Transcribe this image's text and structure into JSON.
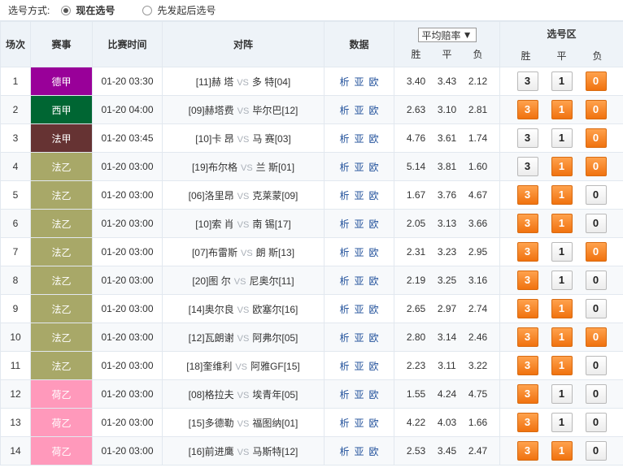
{
  "topbar": {
    "label": "选号方式:",
    "option_current": "现在选号",
    "option_later": "先发起后选号"
  },
  "header": {
    "num": "场次",
    "league": "赛事",
    "time": "比赛时间",
    "match": "对阵",
    "data": "数据",
    "odds_select": "平均赔率",
    "odds_cols": [
      "胜",
      "平",
      "负"
    ],
    "pick_title": "选号区",
    "pick_cols": [
      "胜",
      "平",
      "负"
    ]
  },
  "data_links": [
    "析",
    "亚",
    "欧"
  ],
  "vs_text": "VS",
  "colors": {
    "德甲": "#990099",
    "西甲": "#006633",
    "法甲": "#663333",
    "法乙": "#a8a868",
    "荷乙": "#ff99bb",
    "selected": "#f0720f"
  },
  "matches": [
    {
      "num": "1",
      "league": "德甲",
      "lclass": "c-dejia",
      "time": "01-20 03:30",
      "home_rank": "[11]",
      "home": "赫 塔",
      "away": "多 特",
      "away_rank": "[04]",
      "odds": [
        "3.40",
        "3.43",
        "2.12"
      ],
      "picks": [
        false,
        false,
        true
      ]
    },
    {
      "num": "2",
      "league": "西甲",
      "lclass": "c-xijia",
      "time": "01-20 04:00",
      "home_rank": "[09]",
      "home": "赫塔费",
      "away": "毕尔巴",
      "away_rank": "[12]",
      "odds": [
        "2.63",
        "3.10",
        "2.81"
      ],
      "picks": [
        true,
        true,
        true
      ]
    },
    {
      "num": "3",
      "league": "法甲",
      "lclass": "c-fajia",
      "time": "01-20 03:45",
      "home_rank": "[10]",
      "home": "卡 昂",
      "away": "马 赛",
      "away_rank": "[03]",
      "odds": [
        "4.76",
        "3.61",
        "1.74"
      ],
      "picks": [
        false,
        false,
        true
      ]
    },
    {
      "num": "4",
      "league": "法乙",
      "lclass": "c-fayi",
      "time": "01-20 03:00",
      "home_rank": "[19]",
      "home": "布尔格",
      "away": "兰 斯",
      "away_rank": "[01]",
      "odds": [
        "5.14",
        "3.81",
        "1.60"
      ],
      "picks": [
        false,
        true,
        true
      ]
    },
    {
      "num": "5",
      "league": "法乙",
      "lclass": "c-fayi",
      "time": "01-20 03:00",
      "home_rank": "[06]",
      "home": "洛里昂",
      "away": "克莱蒙",
      "away_rank": "[09]",
      "odds": [
        "1.67",
        "3.76",
        "4.67"
      ],
      "picks": [
        true,
        true,
        false
      ]
    },
    {
      "num": "6",
      "league": "法乙",
      "lclass": "c-fayi",
      "time": "01-20 03:00",
      "home_rank": "[10]",
      "home": "索 肖",
      "away": "南 锡",
      "away_rank": "[17]",
      "odds": [
        "2.05",
        "3.13",
        "3.66"
      ],
      "picks": [
        true,
        true,
        false
      ]
    },
    {
      "num": "7",
      "league": "法乙",
      "lclass": "c-fayi",
      "time": "01-20 03:00",
      "home_rank": "[07]",
      "home": "布雷斯",
      "away": "朗 斯",
      "away_rank": "[13]",
      "odds": [
        "2.31",
        "3.23",
        "2.95"
      ],
      "picks": [
        true,
        false,
        true
      ]
    },
    {
      "num": "8",
      "league": "法乙",
      "lclass": "c-fayi",
      "time": "01-20 03:00",
      "home_rank": "[20]",
      "home": "图 尔",
      "away": "尼奥尔",
      "away_rank": "[11]",
      "odds": [
        "2.19",
        "3.25",
        "3.16"
      ],
      "picks": [
        true,
        false,
        false
      ]
    },
    {
      "num": "9",
      "league": "法乙",
      "lclass": "c-fayi",
      "time": "01-20 03:00",
      "home_rank": "[14]",
      "home": "奥尔良",
      "away": "欧塞尔",
      "away_rank": "[16]",
      "odds": [
        "2.65",
        "2.97",
        "2.74"
      ],
      "picks": [
        true,
        true,
        false
      ]
    },
    {
      "num": "10",
      "league": "法乙",
      "lclass": "c-fayi",
      "time": "01-20 03:00",
      "home_rank": "[12]",
      "home": "瓦朗谢",
      "away": "阿弗尔",
      "away_rank": "[05]",
      "odds": [
        "2.80",
        "3.14",
        "2.46"
      ],
      "picks": [
        true,
        true,
        true
      ]
    },
    {
      "num": "11",
      "league": "法乙",
      "lclass": "c-fayi",
      "time": "01-20 03:00",
      "home_rank": "[18]",
      "home": "奎维利",
      "away": "阿雅GF",
      "away_rank": "[15]",
      "odds": [
        "2.23",
        "3.11",
        "3.22"
      ],
      "picks": [
        true,
        true,
        false
      ]
    },
    {
      "num": "12",
      "league": "荷乙",
      "lclass": "c-heyi",
      "time": "01-20 03:00",
      "home_rank": "[08]",
      "home": "格拉夫",
      "away": "埃青年",
      "away_rank": "[05]",
      "odds": [
        "1.55",
        "4.24",
        "4.75"
      ],
      "picks": [
        true,
        false,
        false
      ]
    },
    {
      "num": "13",
      "league": "荷乙",
      "lclass": "c-heyi",
      "time": "01-20 03:00",
      "home_rank": "[15]",
      "home": "多德勒",
      "away": "福图纳",
      "away_rank": "[01]",
      "odds": [
        "4.22",
        "4.03",
        "1.66"
      ],
      "picks": [
        true,
        false,
        false
      ]
    },
    {
      "num": "14",
      "league": "荷乙",
      "lclass": "c-heyi",
      "time": "01-20 03:00",
      "home_rank": "[16]",
      "home": "前进鹰",
      "away": "马斯特",
      "away_rank": "[12]",
      "odds": [
        "2.53",
        "3.45",
        "2.47"
      ],
      "picks": [
        true,
        true,
        false
      ]
    }
  ]
}
